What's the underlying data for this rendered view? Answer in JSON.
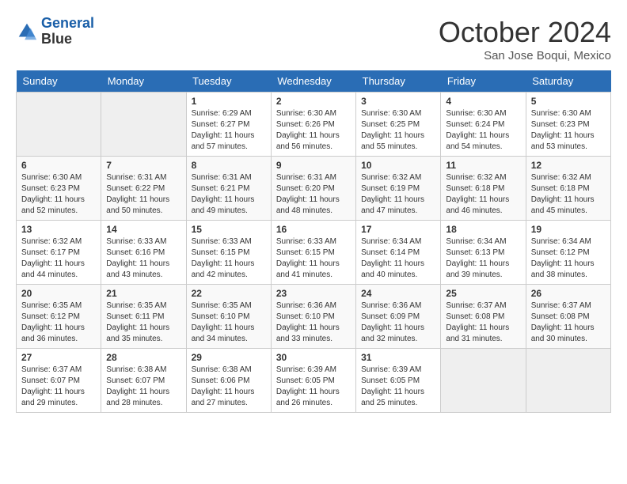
{
  "header": {
    "logo_line1": "General",
    "logo_line2": "Blue",
    "month": "October 2024",
    "location": "San Jose Boqui, Mexico"
  },
  "days_of_week": [
    "Sunday",
    "Monday",
    "Tuesday",
    "Wednesday",
    "Thursday",
    "Friday",
    "Saturday"
  ],
  "weeks": [
    [
      {
        "day": "",
        "empty": true
      },
      {
        "day": "",
        "empty": true
      },
      {
        "day": "1",
        "sunrise": "6:29 AM",
        "sunset": "6:27 PM",
        "daylight": "11 hours and 57 minutes."
      },
      {
        "day": "2",
        "sunrise": "6:30 AM",
        "sunset": "6:26 PM",
        "daylight": "11 hours and 56 minutes."
      },
      {
        "day": "3",
        "sunrise": "6:30 AM",
        "sunset": "6:25 PM",
        "daylight": "11 hours and 55 minutes."
      },
      {
        "day": "4",
        "sunrise": "6:30 AM",
        "sunset": "6:24 PM",
        "daylight": "11 hours and 54 minutes."
      },
      {
        "day": "5",
        "sunrise": "6:30 AM",
        "sunset": "6:23 PM",
        "daylight": "11 hours and 53 minutes."
      }
    ],
    [
      {
        "day": "6",
        "sunrise": "6:30 AM",
        "sunset": "6:23 PM",
        "daylight": "11 hours and 52 minutes."
      },
      {
        "day": "7",
        "sunrise": "6:31 AM",
        "sunset": "6:22 PM",
        "daylight": "11 hours and 50 minutes."
      },
      {
        "day": "8",
        "sunrise": "6:31 AM",
        "sunset": "6:21 PM",
        "daylight": "11 hours and 49 minutes."
      },
      {
        "day": "9",
        "sunrise": "6:31 AM",
        "sunset": "6:20 PM",
        "daylight": "11 hours and 48 minutes."
      },
      {
        "day": "10",
        "sunrise": "6:32 AM",
        "sunset": "6:19 PM",
        "daylight": "11 hours and 47 minutes."
      },
      {
        "day": "11",
        "sunrise": "6:32 AM",
        "sunset": "6:18 PM",
        "daylight": "11 hours and 46 minutes."
      },
      {
        "day": "12",
        "sunrise": "6:32 AM",
        "sunset": "6:18 PM",
        "daylight": "11 hours and 45 minutes."
      }
    ],
    [
      {
        "day": "13",
        "sunrise": "6:32 AM",
        "sunset": "6:17 PM",
        "daylight": "11 hours and 44 minutes."
      },
      {
        "day": "14",
        "sunrise": "6:33 AM",
        "sunset": "6:16 PM",
        "daylight": "11 hours and 43 minutes."
      },
      {
        "day": "15",
        "sunrise": "6:33 AM",
        "sunset": "6:15 PM",
        "daylight": "11 hours and 42 minutes."
      },
      {
        "day": "16",
        "sunrise": "6:33 AM",
        "sunset": "6:15 PM",
        "daylight": "11 hours and 41 minutes."
      },
      {
        "day": "17",
        "sunrise": "6:34 AM",
        "sunset": "6:14 PM",
        "daylight": "11 hours and 40 minutes."
      },
      {
        "day": "18",
        "sunrise": "6:34 AM",
        "sunset": "6:13 PM",
        "daylight": "11 hours and 39 minutes."
      },
      {
        "day": "19",
        "sunrise": "6:34 AM",
        "sunset": "6:12 PM",
        "daylight": "11 hours and 38 minutes."
      }
    ],
    [
      {
        "day": "20",
        "sunrise": "6:35 AM",
        "sunset": "6:12 PM",
        "daylight": "11 hours and 36 minutes."
      },
      {
        "day": "21",
        "sunrise": "6:35 AM",
        "sunset": "6:11 PM",
        "daylight": "11 hours and 35 minutes."
      },
      {
        "day": "22",
        "sunrise": "6:35 AM",
        "sunset": "6:10 PM",
        "daylight": "11 hours and 34 minutes."
      },
      {
        "day": "23",
        "sunrise": "6:36 AM",
        "sunset": "6:10 PM",
        "daylight": "11 hours and 33 minutes."
      },
      {
        "day": "24",
        "sunrise": "6:36 AM",
        "sunset": "6:09 PM",
        "daylight": "11 hours and 32 minutes."
      },
      {
        "day": "25",
        "sunrise": "6:37 AM",
        "sunset": "6:08 PM",
        "daylight": "11 hours and 31 minutes."
      },
      {
        "day": "26",
        "sunrise": "6:37 AM",
        "sunset": "6:08 PM",
        "daylight": "11 hours and 30 minutes."
      }
    ],
    [
      {
        "day": "27",
        "sunrise": "6:37 AM",
        "sunset": "6:07 PM",
        "daylight": "11 hours and 29 minutes."
      },
      {
        "day": "28",
        "sunrise": "6:38 AM",
        "sunset": "6:07 PM",
        "daylight": "11 hours and 28 minutes."
      },
      {
        "day": "29",
        "sunrise": "6:38 AM",
        "sunset": "6:06 PM",
        "daylight": "11 hours and 27 minutes."
      },
      {
        "day": "30",
        "sunrise": "6:39 AM",
        "sunset": "6:05 PM",
        "daylight": "11 hours and 26 minutes."
      },
      {
        "day": "31",
        "sunrise": "6:39 AM",
        "sunset": "6:05 PM",
        "daylight": "11 hours and 25 minutes."
      },
      {
        "day": "",
        "empty": true
      },
      {
        "day": "",
        "empty": true
      }
    ]
  ]
}
